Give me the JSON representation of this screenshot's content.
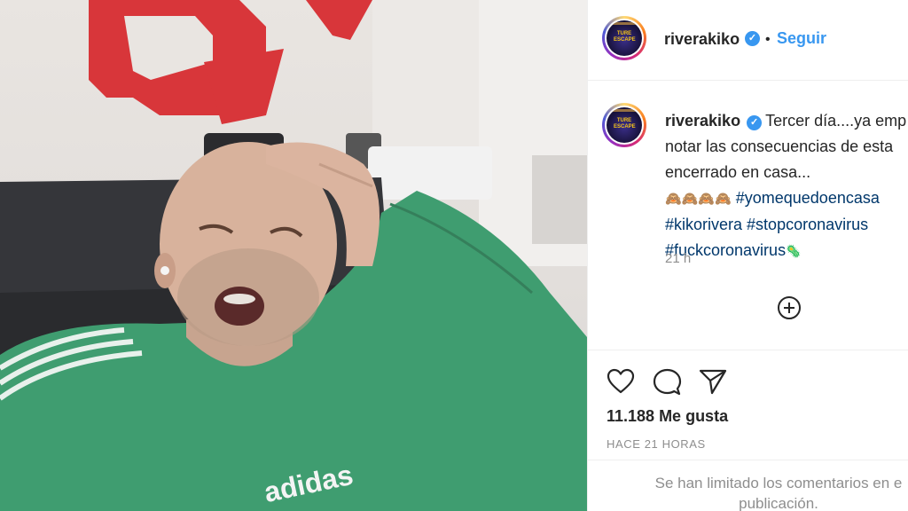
{
  "post": {
    "username": "riverakiko",
    "follow_label": "Seguir",
    "dot": "•",
    "verified_glyph": "✓",
    "avatar_text": "TURE ESCAPE",
    "caption": {
      "username": "riverakiko",
      "line1": "Tercer día....ya emp",
      "line2": "notar las consecuencias de esta",
      "line3": "encerrado en casa...",
      "emojis": "🙈🙈🙈🙈",
      "hashtags": [
        "#yomequedoencasa",
        "#kikorivera",
        "#stopcoronavirus",
        "#fuckcoronavirus"
      ],
      "end_emoji": "🦠"
    },
    "relative_time": "21 h",
    "likes_label": "11.188 Me gusta",
    "posted_ago": "HACE 21 HORAS",
    "comments_limited": {
      "line1": "Se han limitado los comentarios en e",
      "line2": "publicación."
    }
  },
  "photo": {
    "sweatshirt_brand": "adidas"
  },
  "icons": {
    "like": "heart-icon",
    "comment": "comment-bubble-icon",
    "share": "paper-plane-icon",
    "load_more": "plus-circle-icon"
  },
  "colors": {
    "link_blue": "#3897f0",
    "hashtag": "#00376b",
    "muted": "#8e8e8e",
    "wall_logo_red": "#d8363a",
    "sweatshirt_green": "#3f9d70"
  }
}
